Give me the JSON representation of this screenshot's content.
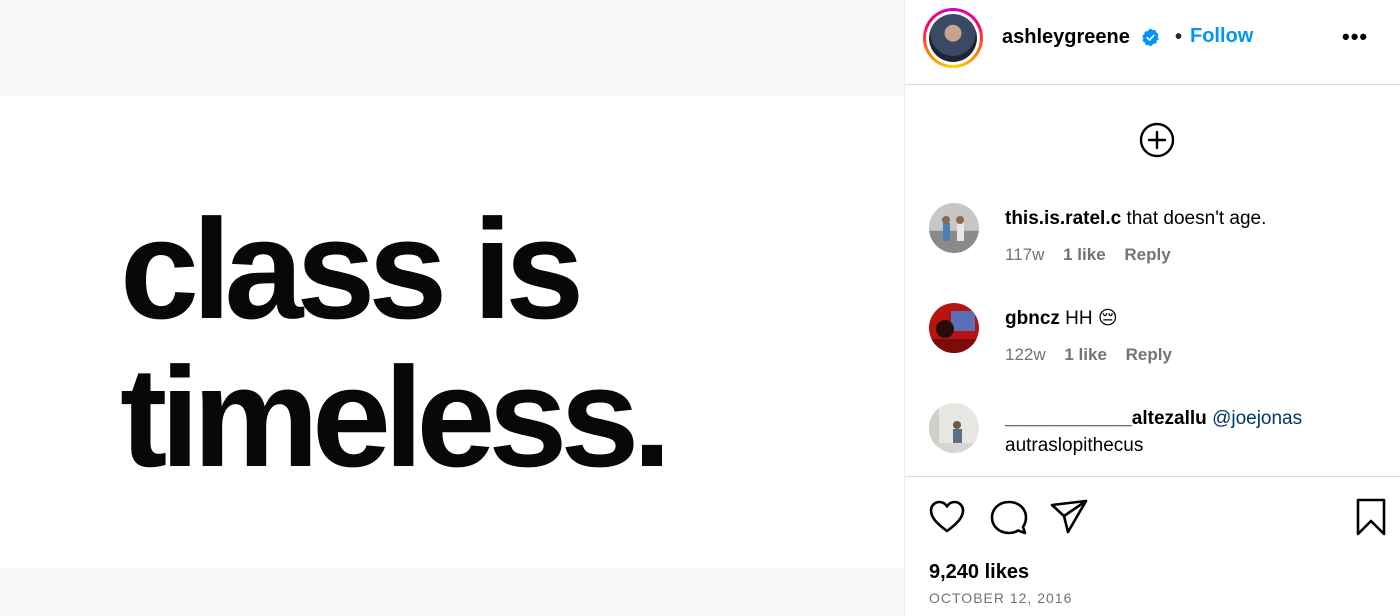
{
  "post": {
    "image_text": {
      "line1": "class is",
      "line2": "timeless."
    }
  },
  "header": {
    "username": "ashleygreene",
    "separator": "•",
    "follow_label": "Follow",
    "more_label": "•••",
    "verified": true
  },
  "comments": [
    {
      "username": "this.is.ratel.c",
      "text": "that doesn't age.",
      "age": "117w",
      "likes": "1 like",
      "reply": "Reply"
    },
    {
      "username": "gbncz",
      "text": "HH 😔",
      "age": "122w",
      "likes": "1 like",
      "reply": "Reply"
    },
    {
      "username": "____________altezallu",
      "mention": "@joejonas",
      "text": "autraslopithecus"
    }
  ],
  "footer": {
    "likes": "9,240 likes",
    "date": "OCTOBER 12, 2016"
  },
  "colors": {
    "accent": "#0095f6",
    "verified": "#0095f6",
    "mention": "#00376b",
    "meta_text": "#737373"
  },
  "icons": [
    "verified-badge-icon",
    "more-options-icon",
    "add-circle-icon",
    "heart-icon",
    "comment-icon",
    "share-icon",
    "bookmark-icon"
  ]
}
